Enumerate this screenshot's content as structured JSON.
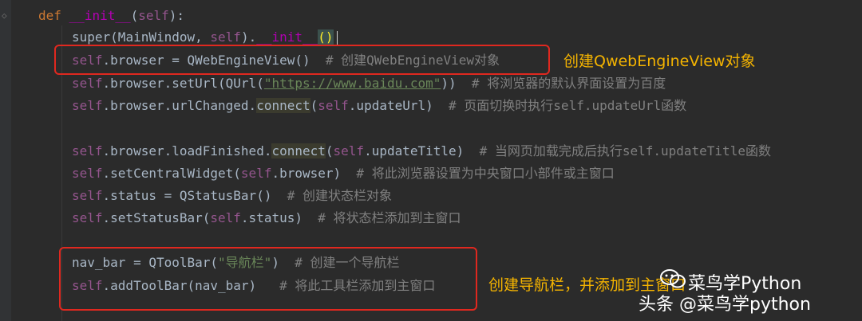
{
  "code": {
    "line1": {
      "def": "def",
      "name": "__init__",
      "open": "(",
      "self": "self",
      "close": "):"
    },
    "line2": {
      "super": "super",
      "args_open": "(MainWindow, ",
      "self": "self",
      "mid": ").",
      "init": "__init__",
      "call": "()"
    },
    "line3": {
      "self": "self",
      "code": ".browser = QWebEngineView()",
      "comment": "# 创建QWebEngineView对象"
    },
    "line4": {
      "self": "self",
      "code1": ".browser.setUrl(QUrl(",
      "url": "\"https://www.baidu.com\"",
      "code2": "))",
      "comment": "# 将浏览器的默认界面设置为百度"
    },
    "line5": {
      "self": "self",
      "code1": ".browser.urlChanged.",
      "connect": "connect",
      "code2": "(",
      "self2": "self",
      "code3": ".updateUrl)",
      "comment": "# 页面切换时执行self.updateUrl函数"
    },
    "line6": {
      "self": "self",
      "code1": ".browser.loadFinished.",
      "connect": "connect",
      "code2": "(",
      "self2": "self",
      "code3": ".updateTitle)",
      "comment": "# 当网页加载完成后执行self.updateTitle函数"
    },
    "line7": {
      "self": "self",
      "code1": ".setCentralWidget(",
      "self2": "self",
      "code2": ".browser)",
      "comment": "# 将此浏览器设置为中央窗口小部件或主窗口"
    },
    "line8": {
      "self": "self",
      "code": ".status = QStatusBar()",
      "comment": "# 创建状态栏对象"
    },
    "line9": {
      "self": "self",
      "code1": ".setStatusBar(",
      "self2": "self",
      "code2": ".status)",
      "comment": "# 将状态栏添加到主窗口"
    },
    "line10": {
      "code1": "nav_bar = QToolBar(",
      "str": "\"导航栏\"",
      "code2": ")",
      "comment": "# 创建一个导航栏"
    },
    "line11": {
      "self": "self",
      "code": ".addToolBar(nav_bar)",
      "comment": "# 将此工具栏添加到主窗口"
    }
  },
  "annotations": {
    "note1": "创建QwebEngineView对象",
    "note2": "创建导航栏，并添加到主窗口"
  },
  "watermark": {
    "line1": "菜鸟学Python",
    "line2": "头条 @菜鸟学python"
  },
  "colors": {
    "background": "#2b2b2b",
    "keyword": "#cc7832",
    "self": "#94558d",
    "string": "#6a8759",
    "comment": "#808080",
    "highlight_box": "#e0281f",
    "annotation_text": "#f5b400"
  }
}
